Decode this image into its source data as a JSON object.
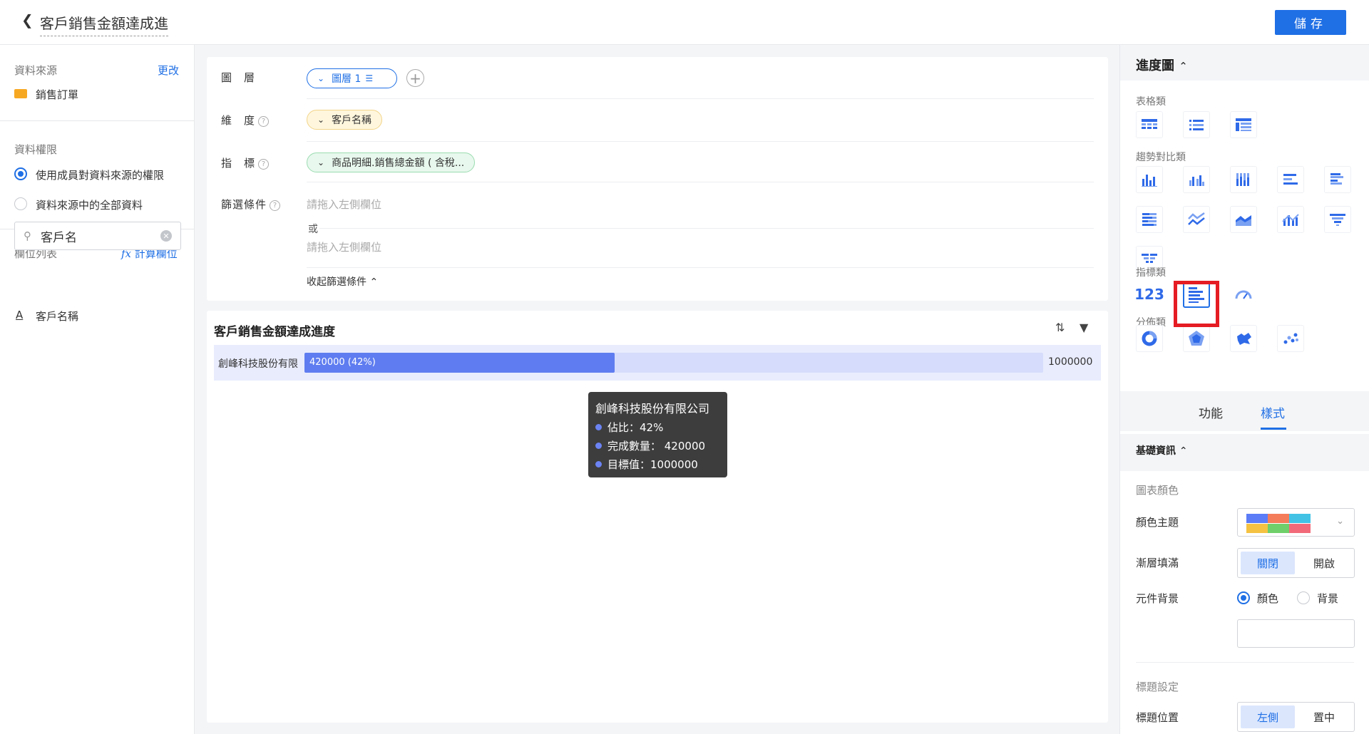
{
  "header": {
    "title": "客戶銷售金額達成進",
    "save_label": "儲存"
  },
  "left": {
    "source_label": "資料來源",
    "source_change": "更改",
    "source_name": "銷售訂單",
    "perm_label": "資料權限",
    "perm_options": [
      "使用成員對資料來源的權限",
      "資料來源中的全部資料"
    ],
    "fields_label": "欄位列表",
    "calc_field": "計算欄位",
    "calc_prefix": "fx",
    "search_value": "客戶名",
    "field_type": "A",
    "field_item": "客戶名稱"
  },
  "config": {
    "layer_label": "圖　層",
    "layer_pill": "圖層 1",
    "dim_label": "維　度",
    "dim_pill": "客戶名稱",
    "metric_label": "指　標",
    "metric_pill": "商品明細.銷售總金額 ( 含稅...",
    "filter_label": "篩選條件",
    "filter_ph1": "請拖入左側欄位",
    "filter_or": "或",
    "filter_ph2": "請拖入左側欄位",
    "collapse_label": "收起篩選條件"
  },
  "chart": {
    "title": "客戶銷售金額達成進度",
    "tooltip": {
      "title": "創峰科技股份有限公司",
      "rows": [
        "佔比：42%",
        "完成數量： 420000",
        "目標值：1000000"
      ]
    }
  },
  "chart_data": {
    "type": "bar",
    "orientation": "horizontal-progress",
    "categories": [
      "創峰科技股份有限"
    ],
    "values": [
      420000
    ],
    "targets": [
      1000000
    ],
    "percent": [
      42
    ],
    "value_label": "420000 (42%)",
    "target_label": "1000000",
    "title": "客戶銷售金額達成進度",
    "colors": {
      "fill": "#5f7df0",
      "track": "#d6dcfb"
    }
  },
  "right": {
    "header": "進度圖",
    "cat_table": "表格類",
    "cat_trend": "趨勢對比類",
    "cat_indicator": "指標類",
    "indicator_num": "123",
    "cat_dist": "分佈類",
    "tabs": [
      "功能",
      "樣式"
    ],
    "basic_title": "基礎資訊",
    "chart_color": "圖表顏色",
    "color_theme": "顏色主題",
    "gradient": "漸層填滿",
    "gradient_opts": [
      "關閉",
      "開啟"
    ],
    "comp_bg": "元件背景",
    "bg_opts": [
      "顏色",
      "背景"
    ],
    "title_setting": "標題設定",
    "title_pos": "標題位置",
    "title_pos_opts": [
      "左側",
      "置中"
    ],
    "theme_colors": [
      "#5b7cf6",
      "#f47c5a",
      "#42c3e6",
      "#f5c242",
      "#6fcf6a",
      "#f26a7a"
    ]
  }
}
